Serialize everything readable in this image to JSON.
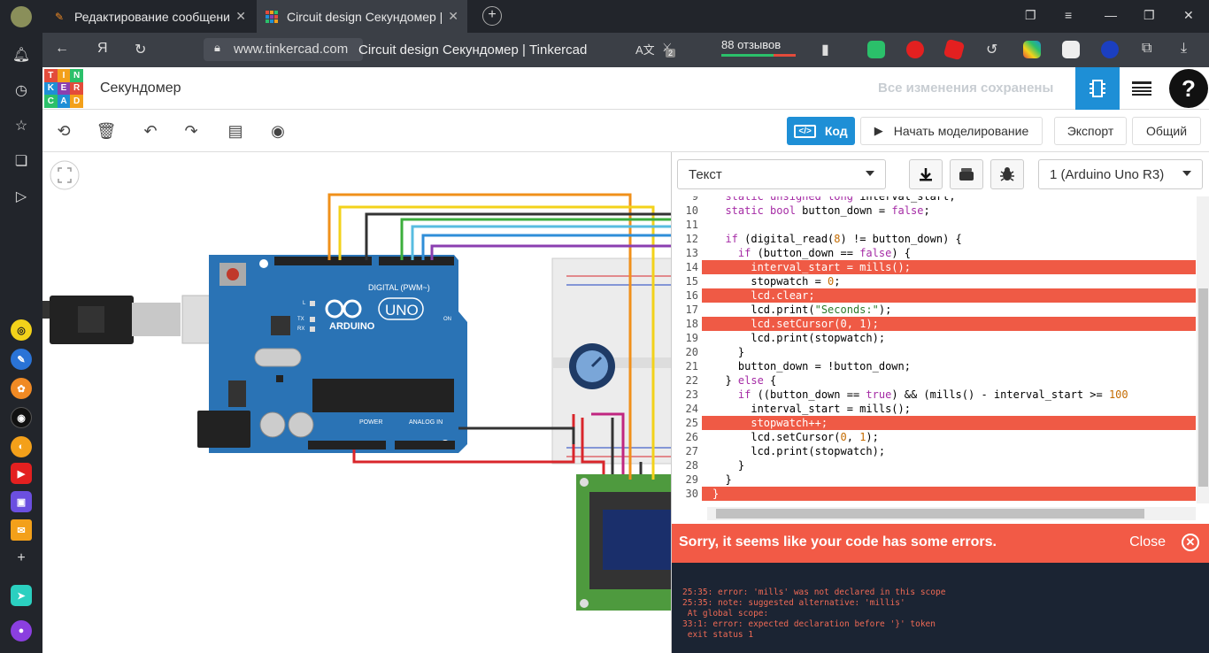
{
  "browser": {
    "tabs": [
      {
        "title": "Редактирование сообщения"
      },
      {
        "title": "Circuit design Секундомер | Tinkercad"
      }
    ],
    "url": "www.tinkercad.com",
    "page_title": "Circuit design Секундомер | Tinkercad",
    "reviews": "88 отзывов",
    "extension_badge": "2"
  },
  "tinkercad": {
    "logo_letters": [
      "TIN",
      "KER",
      "CAD"
    ],
    "project_name": "Секундомер",
    "save_status": "Все изменения сохранены",
    "toolbar": {
      "code_label": "Код",
      "simulate_label": "Начать моделирование",
      "export_label": "Экспорт",
      "share_label": "Общий"
    }
  },
  "code_panel": {
    "mode": "Текст",
    "device": "1 (Arduino Uno R3)",
    "lines": [
      {
        "n": "9",
        "t": "  static unsigned long interval_start;",
        "err": false
      },
      {
        "n": "10",
        "t": "  static bool button_down = false;",
        "err": false
      },
      {
        "n": "11",
        "t": "",
        "err": false
      },
      {
        "n": "12",
        "t": "  if (digital_read(8) != button_down) {",
        "err": false
      },
      {
        "n": "13",
        "t": "    if (button_down == false) {",
        "err": false
      },
      {
        "n": "14",
        "t": "      interval_start = mills();",
        "err": true
      },
      {
        "n": "15",
        "t": "      stopwatch = 0;",
        "err": false
      },
      {
        "n": "16",
        "t": "      lcd.clear;",
        "err": true
      },
      {
        "n": "17",
        "t": "      lcd.print(\"Seconds:\");",
        "err": false
      },
      {
        "n": "18",
        "t": "      lcd.setCursor(0, 1);",
        "err": true
      },
      {
        "n": "19",
        "t": "      lcd.print(stopwatch);",
        "err": false
      },
      {
        "n": "20",
        "t": "    }",
        "err": false
      },
      {
        "n": "21",
        "t": "    button_down = !button_down;",
        "err": false
      },
      {
        "n": "22",
        "t": "  } else {",
        "err": false
      },
      {
        "n": "23",
        "t": "    if ((button_down == true) && (mills() - interval_start >= 100",
        "err": false
      },
      {
        "n": "24",
        "t": "      interval_start = mills();",
        "err": false
      },
      {
        "n": "25",
        "t": "      stopwatch++;",
        "err": true
      },
      {
        "n": "26",
        "t": "      lcd.setCursor(0, 1);",
        "err": false
      },
      {
        "n": "27",
        "t": "      lcd.print(stopwatch);",
        "err": false
      },
      {
        "n": "28",
        "t": "    }",
        "err": false
      },
      {
        "n": "29",
        "t": "  }",
        "err": false
      },
      {
        "n": "30",
        "t": "}",
        "err": true
      }
    ],
    "error_banner": "Sorry, it seems like your code has some errors.",
    "close_label": "Close",
    "console": [
      "25:35: error: 'mills' was not declared in this scope",
      "25:35: note: suggested alternative: 'millis'",
      " At global scope:",
      "33:1: error: expected declaration before '}' token",
      " exit status 1"
    ]
  },
  "circuit": {
    "board_brand": "ARDUINO",
    "board_model": "UNO",
    "digital_label": "DIGITAL (PWM~)",
    "power_label": "POWER",
    "analog_label": "ANALOG IN",
    "tx": "TX",
    "rx": "RX",
    "on": "ON",
    "l": "L"
  },
  "colors": {
    "accent": "#1e8fd6",
    "error": "#f25a46",
    "board": "#2a73b5",
    "wire_orange": "#f0901a",
    "wire_yellow": "#f3d21a",
    "wire_black": "#333333",
    "wire_green": "#3cae3c",
    "wire_cyan": "#58bce0",
    "wire_blue": "#2f8ed8",
    "wire_purple": "#8b3fb0",
    "wire_red": "#d9262b"
  }
}
